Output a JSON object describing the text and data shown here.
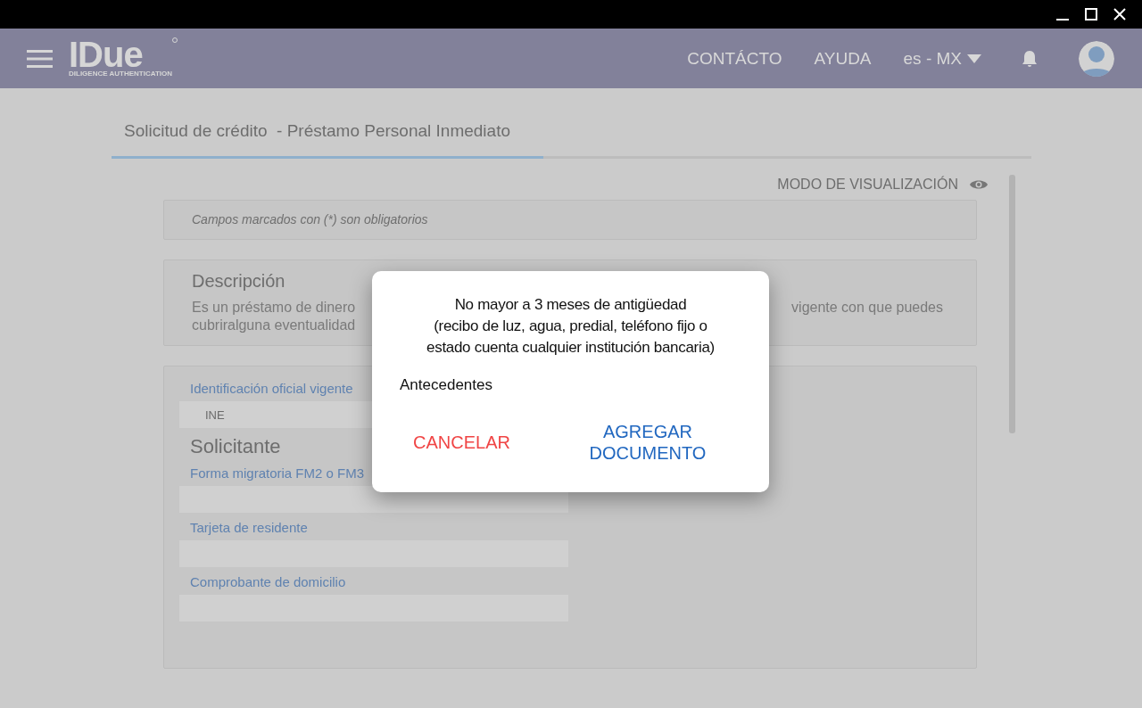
{
  "header": {
    "logo": {
      "name": "IDue",
      "tagline": "DILIGENCE AUTHENTICATION"
    },
    "nav": [
      "CONTÁCTO",
      "AYUDA"
    ],
    "language": "es - MX"
  },
  "page": {
    "tab": {
      "label": "Solicitud de crédito  - Préstamo Personal Inmediato",
      "selected": true
    },
    "view_mode": "MODO DE VISUALIZACIÓN"
  },
  "note": "Campos marcados con (*) son obligatorios",
  "description": {
    "title": "Descripción",
    "text_left": [
      "Es un préstamo de dinero",
      "cubriralguna eventualidad"
    ],
    "text_right": "vigente con que puedes"
  },
  "form": [
    {
      "kind": "field",
      "label": "Identificación oficial vigente",
      "value": "INE"
    },
    {
      "kind": "heading",
      "label": "Solicitante"
    },
    {
      "kind": "field",
      "label": "Forma migratoria FM2 o FM3"
    },
    {
      "kind": "field",
      "label": "Tarjeta de residente"
    },
    {
      "kind": "field",
      "label": "Comprobante de domicilio"
    }
  ],
  "dialog": {
    "message": [
      "No mayor a 3 meses de antigüedad",
      "(recibo de luz, agua, predial, teléfono fijo o",
      "estado cuenta cualquier institución bancaria)"
    ],
    "subtitle": "Antecedentes",
    "buttons": [
      {
        "label": "CANCELAR",
        "kind": "cancel"
      },
      {
        "label": "AGREGAR DOCUMENTO",
        "kind": "confirm"
      }
    ]
  }
}
